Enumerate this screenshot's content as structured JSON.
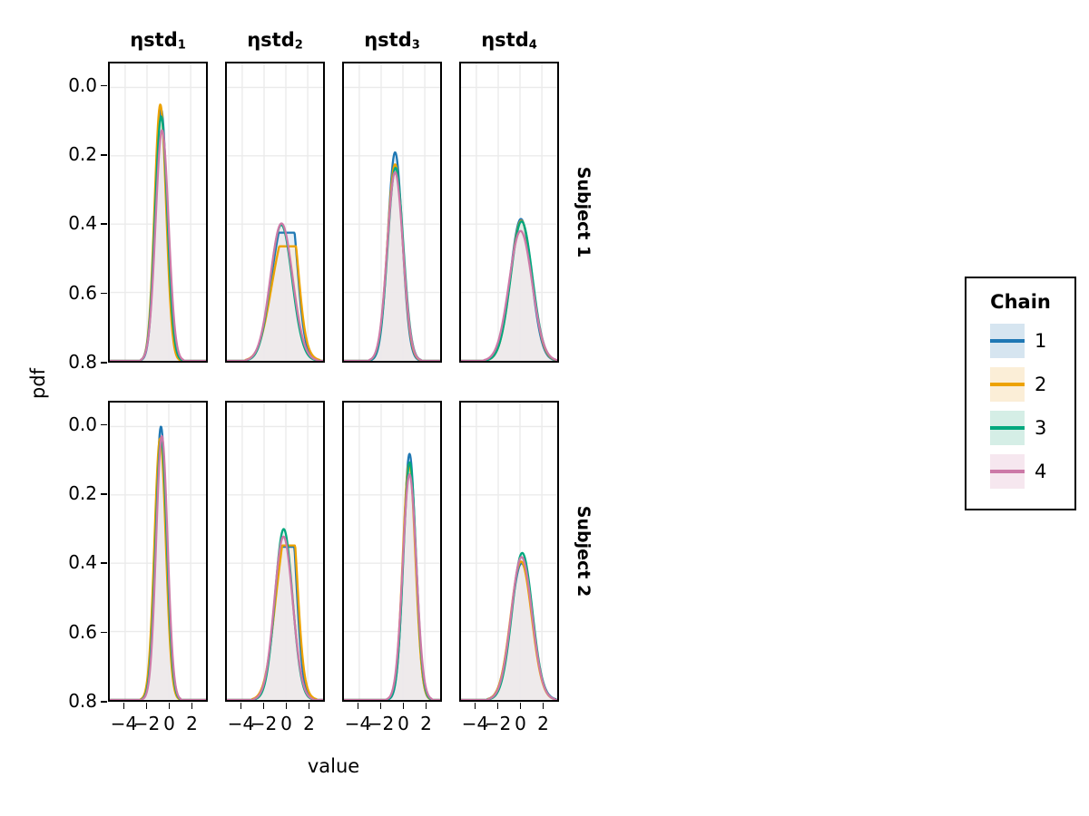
{
  "axes": {
    "x_title": "value",
    "y_title": "pdf",
    "x_ticks": [
      "-4",
      "-2",
      "0",
      "2"
    ],
    "y_ticks": [
      "0.8",
      "0.6",
      "0.4",
      "0.2",
      "0.0"
    ]
  },
  "columns": [
    {
      "base": "ηstd",
      "sub": "1"
    },
    {
      "base": "ηstd",
      "sub": "2"
    },
    {
      "base": "ηstd",
      "sub": "3"
    },
    {
      "base": "ηstd",
      "sub": "4"
    }
  ],
  "rows": [
    "Subject 1",
    "Subject 2"
  ],
  "legend": {
    "title": "Chain",
    "items": [
      {
        "label": "1",
        "color": "#1f78b4",
        "fill": "#d6e5f0"
      },
      {
        "label": "2",
        "color": "#eda200",
        "fill": "#fbeed7"
      },
      {
        "label": "3",
        "color": "#00a87e",
        "fill": "#d5eee6"
      },
      {
        "label": "4",
        "color": "#cc79a7",
        "fill": "#f6e7ef"
      }
    ]
  },
  "chart_data": {
    "type": "line",
    "title": "",
    "subtitle": "",
    "xlabel": "value",
    "ylabel": "pdf",
    "xlim": [
      -5.4,
      3.4
    ],
    "ylim": [
      0.0,
      0.87
    ],
    "grid": true,
    "legend_position": "right",
    "legend_title": "Chain",
    "facet_columns": [
      "ηstd₁",
      "ηstd₂",
      "ηstd₃",
      "ηstd₄"
    ],
    "facet_rows": [
      "Subject 1",
      "Subject 2"
    ],
    "x_ticks": [
      -4,
      -2,
      0,
      2
    ],
    "y_ticks": [
      0.0,
      0.2,
      0.4,
      0.6,
      0.8
    ],
    "description": "Kernel density (pdf) of posterior draws per MCMC chain, faceted by parameter (columns) and subject (rows); filled areas under each curve.",
    "panels": [
      {
        "row": "Subject 1",
        "col": "ηstd₁",
        "series": [
          {
            "name": "1",
            "mean": -0.7,
            "sd": 0.54,
            "peak": 0.735,
            "skew": 0.0
          },
          {
            "name": "2",
            "mean": -0.78,
            "sd": 0.53,
            "peak": 0.75,
            "skew": 0.05
          },
          {
            "name": "3",
            "mean": -0.7,
            "sd": 0.56,
            "peak": 0.715,
            "skew": 0.0
          },
          {
            "name": "4",
            "mean": -0.62,
            "sd": 0.59,
            "peak": 0.675,
            "skew": 0.0
          }
        ]
      },
      {
        "row": "Subject 1",
        "col": "ηstd₂",
        "series": [
          {
            "name": "1",
            "mean": -0.35,
            "sd": 1.05,
            "peak": 0.375,
            "skew": 0.0,
            "bump": {
              "mean": 0.55,
              "sd": 0.55,
              "peak": 0.34
            }
          },
          {
            "name": "2",
            "mean": -0.3,
            "sd": 1.1,
            "peak": 0.33,
            "skew": 0.0,
            "bump": {
              "mean": 0.62,
              "sd": 0.58,
              "peak": 0.335
            }
          },
          {
            "name": "3",
            "mean": -0.42,
            "sd": 0.98,
            "peak": 0.398,
            "skew": 0.0
          },
          {
            "name": "4",
            "mean": -0.4,
            "sd": 1.02,
            "peak": 0.402,
            "skew": 0.0
          }
        ]
      },
      {
        "row": "Subject 1",
        "col": "ηstd₃",
        "series": [
          {
            "name": "1",
            "mean": -0.72,
            "sd": 0.66,
            "peak": 0.61,
            "skew": 0.0
          },
          {
            "name": "2",
            "mean": -0.72,
            "sd": 0.7,
            "peak": 0.575,
            "skew": 0.0
          },
          {
            "name": "3",
            "mean": -0.68,
            "sd": 0.71,
            "peak": 0.565,
            "skew": 0.0
          },
          {
            "name": "4",
            "mean": -0.72,
            "sd": 0.72,
            "peak": 0.552,
            "skew": 0.0
          }
        ]
      },
      {
        "row": "Subject 1",
        "col": "ηstd₄",
        "series": [
          {
            "name": "1",
            "mean": 0.08,
            "sd": 0.96,
            "peak": 0.415,
            "skew": 0.0
          },
          {
            "name": "2",
            "mean": 0.12,
            "sd": 0.98,
            "peak": 0.41,
            "skew": 0.0
          },
          {
            "name": "3",
            "mean": 0.14,
            "sd": 0.99,
            "peak": 0.408,
            "skew": 0.0
          },
          {
            "name": "4",
            "mean": 0.05,
            "sd": 1.05,
            "peak": 0.38,
            "skew": 0.0
          }
        ]
      },
      {
        "row": "Subject 2",
        "col": "ηstd₁",
        "series": [
          {
            "name": "1",
            "mean": -0.72,
            "sd": 0.5,
            "peak": 0.8,
            "skew": 0.0
          },
          {
            "name": "2",
            "mean": -0.8,
            "sd": 0.52,
            "peak": 0.765,
            "skew": 0.0
          },
          {
            "name": "3",
            "mean": -0.7,
            "sd": 0.52,
            "peak": 0.762,
            "skew": 0.0
          },
          {
            "name": "4",
            "mean": -0.64,
            "sd": 0.52,
            "peak": 0.772,
            "skew": 0.0
          }
        ]
      },
      {
        "row": "Subject 2",
        "col": "ηstd₂",
        "series": [
          {
            "name": "1",
            "mean": -0.18,
            "sd": 0.86,
            "peak": 0.448,
            "skew": 0.0,
            "bump": {
              "mean": 0.52,
              "sd": 0.48,
              "peak": 0.44
            }
          },
          {
            "name": "2",
            "mean": -0.15,
            "sd": 0.92,
            "peak": 0.42,
            "skew": 0.0,
            "bump": {
              "mean": 0.6,
              "sd": 0.5,
              "peak": 0.452
            }
          },
          {
            "name": "3",
            "mean": -0.2,
            "sd": 0.8,
            "peak": 0.5,
            "skew": 0.0
          },
          {
            "name": "4",
            "mean": -0.22,
            "sd": 0.84,
            "peak": 0.478,
            "skew": 0.0
          }
        ]
      },
      {
        "row": "Subject 2",
        "col": "ηstd₃",
        "series": [
          {
            "name": "1",
            "mean": 0.6,
            "sd": 0.56,
            "peak": 0.72,
            "skew": 0.0
          },
          {
            "name": "2",
            "mean": 0.56,
            "sd": 0.58,
            "peak": 0.69,
            "skew": 0.0
          },
          {
            "name": "3",
            "mean": 0.62,
            "sd": 0.58,
            "peak": 0.695,
            "skew": 0.0
          },
          {
            "name": "4",
            "mean": 0.6,
            "sd": 0.62,
            "peak": 0.66,
            "skew": 0.0
          }
        ]
      },
      {
        "row": "Subject 2",
        "col": "ηstd₄",
        "series": [
          {
            "name": "1",
            "mean": 0.14,
            "sd": 0.98,
            "peak": 0.4,
            "skew": 0.0
          },
          {
            "name": "2",
            "mean": 0.1,
            "sd": 0.96,
            "peak": 0.405,
            "skew": 0.0
          },
          {
            "name": "3",
            "mean": 0.2,
            "sd": 0.93,
            "peak": 0.43,
            "skew": 0.0
          },
          {
            "name": "4",
            "mean": 0.14,
            "sd": 0.95,
            "peak": 0.418,
            "skew": 0.0
          }
        ]
      }
    ]
  }
}
